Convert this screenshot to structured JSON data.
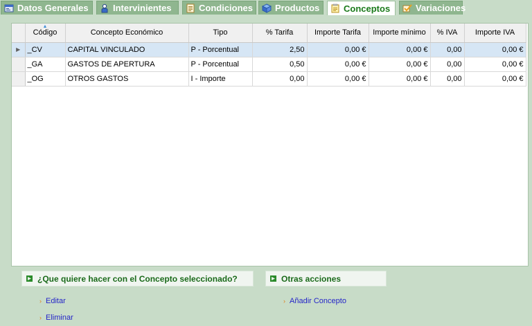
{
  "tabs": [
    {
      "label": "Datos Generales",
      "icon": "general-data-icon"
    },
    {
      "label": "Intervinientes",
      "icon": "person-icon"
    },
    {
      "label": "Condiciones",
      "icon": "document-icon"
    },
    {
      "label": "Productos",
      "icon": "cube-icon"
    },
    {
      "label": "Conceptos",
      "icon": "notepad-icon",
      "active": true
    },
    {
      "label": "Variaciones",
      "icon": "checkmark-icon"
    }
  ],
  "grid": {
    "columns": [
      "Código",
      "Concepto Económico",
      "Tipo",
      "% Tarifa",
      "Importe Tarifa",
      "Importe mínimo",
      "% IVA",
      "Importe IVA"
    ],
    "rows": [
      [
        "_CV",
        "CAPITAL VINCULADO",
        "P - Porcentual",
        "2,50",
        "0,00 €",
        "0,00 €",
        "0,00",
        "0,00 €"
      ],
      [
        "_GA",
        "GASTOS DE APERTURA",
        "P - Porcentual",
        "0,50",
        "0,00 €",
        "0,00 €",
        "0,00",
        "0,00 €"
      ],
      [
        "_OG",
        "OTROS GASTOS",
        "I - Importe",
        "0,00",
        "0,00 €",
        "0,00 €",
        "0,00",
        "0,00 €"
      ]
    ],
    "selected_row_marker": "▶"
  },
  "sections": {
    "selected": {
      "title": "¿Que quiere hacer con el Concepto seleccionado?",
      "actions": [
        "Editar",
        "Eliminar"
      ]
    },
    "other": {
      "title": "Otras acciones",
      "actions": [
        "Añadir Concepto"
      ]
    }
  },
  "colors": {
    "background": "#c8dcc8",
    "tab_inactive": "#8fb68f",
    "tab_active_text": "#1a7a1a",
    "selected_row": "#d6e6f5",
    "link": "#2424c8",
    "section_title": "#1a6a1a"
  }
}
